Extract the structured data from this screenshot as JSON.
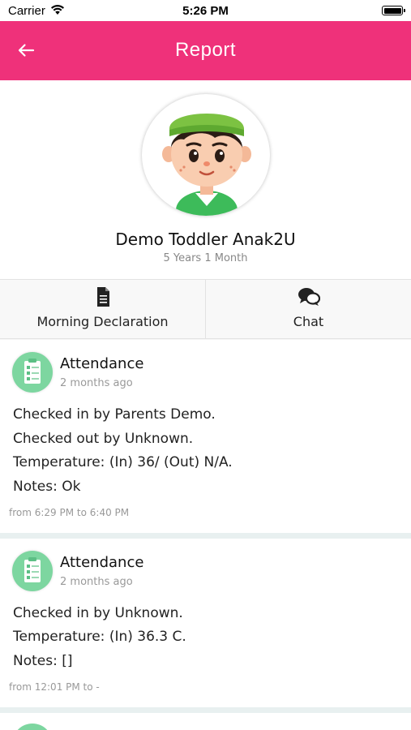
{
  "status_bar": {
    "carrier": "Carrier",
    "time": "5:26 PM"
  },
  "app_bar": {
    "title": "Report",
    "back_icon": "arrow-left-icon"
  },
  "profile": {
    "name": "Demo Toddler Anak2U",
    "age": "5 Years 1 Month"
  },
  "actions": [
    {
      "label": "Morning Declaration",
      "icon": "document-icon"
    },
    {
      "label": "Chat",
      "icon": "chat-bubbles-icon"
    }
  ],
  "colors": {
    "primary": "#ef317a",
    "accent_green": "#7dd6a0",
    "muted": "#999999"
  },
  "records": [
    {
      "title": "Attendance",
      "time_ago": "2 months ago",
      "lines": [
        "Checked in by Parents Demo.",
        "Checked out by Unknown.",
        "Temperature: (In) 36/ (Out) N/A.",
        "Notes: Ok"
      ],
      "range": "from 6:29 PM to 6:40 PM"
    },
    {
      "title": "Attendance",
      "time_ago": "2 months ago",
      "lines": [
        "Checked in by Unknown.",
        "Temperature: (In) 36.3 C.",
        "Notes: []"
      ],
      "range": "from 12:01 PM to -"
    }
  ]
}
